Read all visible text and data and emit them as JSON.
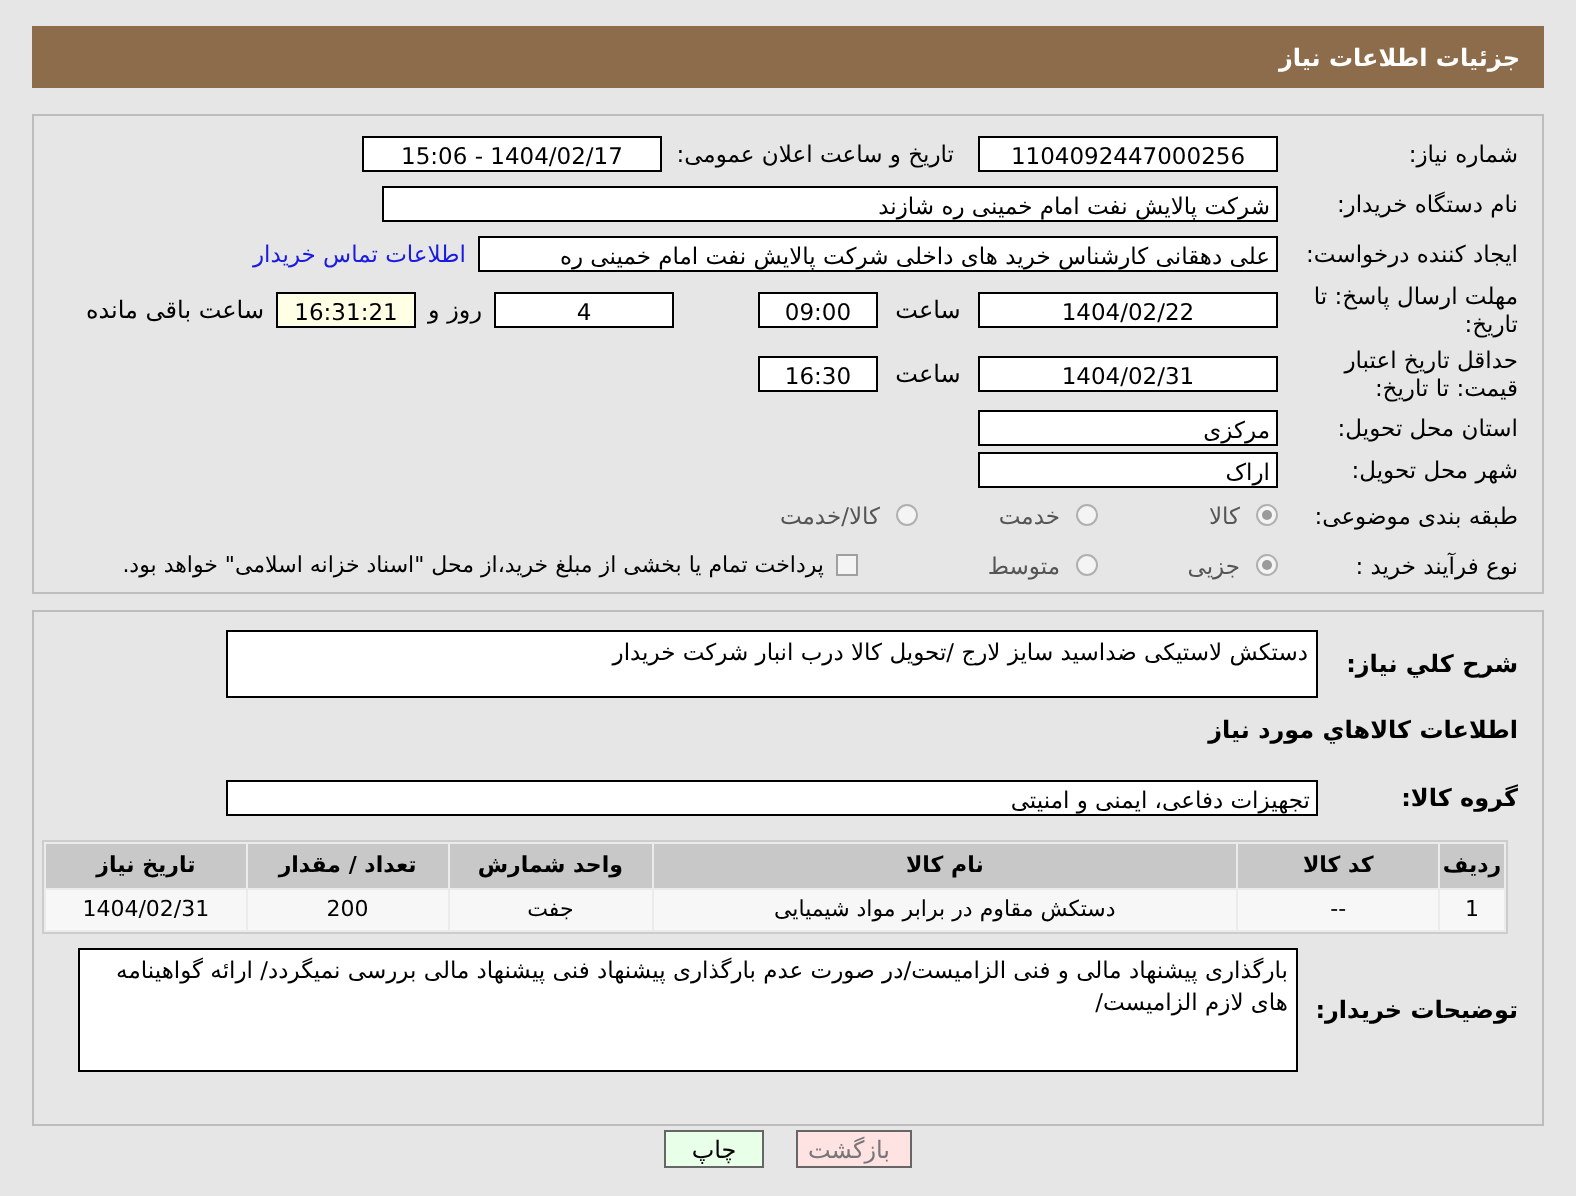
{
  "header": {
    "title": "جزئیات اطلاعات نیاز"
  },
  "need_number": {
    "label": "شماره نیاز:",
    "value": "1104092447000256"
  },
  "announce": {
    "label": "تاریخ و ساعت اعلان عمومی:",
    "value": "1404/02/17 - 15:06"
  },
  "buyer": {
    "label": "نام دستگاه خریدار:",
    "value": "شرکت پالایش نفت امام خمینی  ره  شازند"
  },
  "requester": {
    "label": "ایجاد کننده درخواست:",
    "value": "علی دهقانی کارشناس خرید های داخلی  شرکت پالایش نفت امام خمینی  ره",
    "link": "اطلاعات تماس خریدار"
  },
  "response_deadline": {
    "label": "مهلت ارسال پاسخ: تا تاریخ:",
    "date": "1404/02/22",
    "time_label": "ساعت",
    "time": "09:00",
    "days": "4",
    "days_label": "روز و",
    "remaining": "16:31:21",
    "remaining_label": "ساعت باقی مانده"
  },
  "price_validity": {
    "label": "حداقل تاریخ اعتبار قیمت: تا تاریخ:",
    "date": "1404/02/31",
    "time_label": "ساعت",
    "time": "16:30"
  },
  "province": {
    "label": "استان محل تحویل:",
    "value": "مرکزی"
  },
  "city": {
    "label": "شهر محل تحویل:",
    "value": "اراک"
  },
  "category": {
    "label": "طبقه بندی موضوعی:",
    "options": [
      {
        "label": "کالا",
        "selected": true
      },
      {
        "label": "خدمت",
        "selected": false
      },
      {
        "label": "کالا/خدمت",
        "selected": false
      }
    ]
  },
  "process": {
    "label": "نوع فرآیند خرید :",
    "options": [
      {
        "label": "جزیی",
        "selected": true
      },
      {
        "label": "متوسط",
        "selected": false
      }
    ],
    "payment_note": {
      "checked": false,
      "text": "پرداخت تمام یا بخشی از مبلغ خرید،از محل \"اسناد خزانه اسلامی\" خواهد بود."
    }
  },
  "description": {
    "label": "شرح کلي نياز:",
    "value": "دستکش لاستیکی ضداسید سایز لارج /تحویل کالا درب انبار شرکت خریدار"
  },
  "items_heading": "اطلاعات کالاهاي مورد نياز",
  "goods_group": {
    "label": "گروه کالا:",
    "value": "تجهیزات دفاعی، ایمنی و امنیتی"
  },
  "table": {
    "columns": [
      "ردیف",
      "کد کالا",
      "نام کالا",
      "واحد شمارش",
      "تعداد / مقدار",
      "تاریخ نیاز"
    ],
    "rows": [
      [
        "1",
        "--",
        "دستکش مقاوم در برابر مواد شیمیایی",
        "جفت",
        "200",
        "1404/02/31"
      ]
    ]
  },
  "buyer_notes": {
    "label": "توضیحات خریدار:",
    "value": "بارگذاری پیشنهاد مالی و فنی الزامیست/در صورت عدم بارگذاری پیشنهاد فنی پیشنهاد مالی بررسی نمیگردد/ ارائه گواهینامه های لازم الزامیست/"
  },
  "buttons": [
    {
      "label": "بازگشت",
      "kind": "back"
    },
    {
      "label": "چاپ",
      "kind": "print"
    }
  ]
}
